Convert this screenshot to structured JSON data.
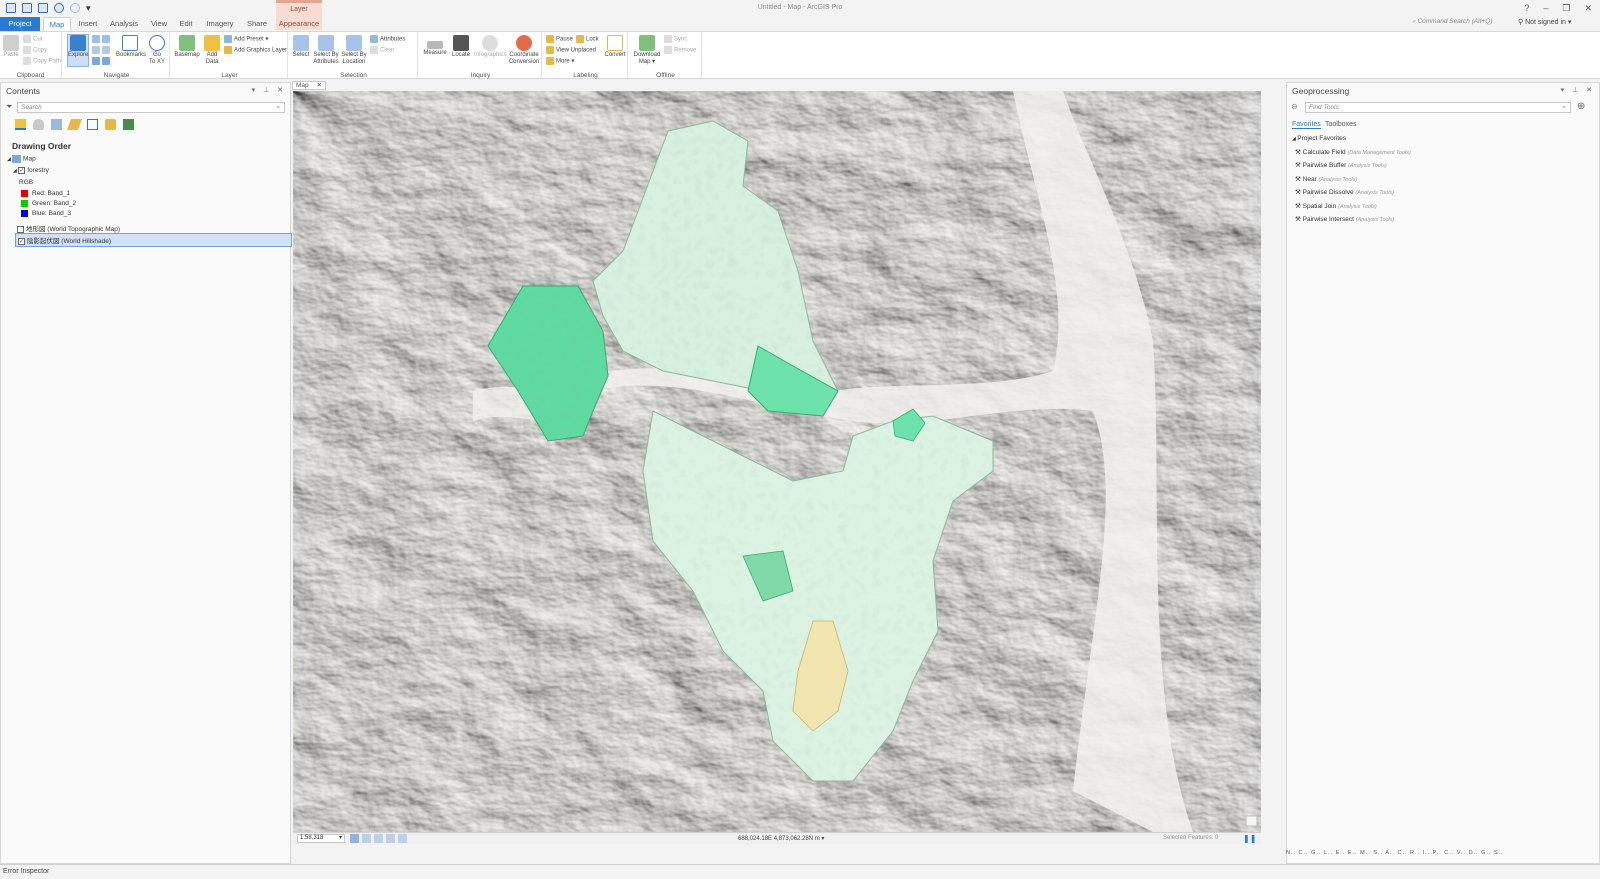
{
  "app": {
    "title": "Untitled - Map - ArcGIS Pro",
    "context_group": "Layer",
    "window_controls": [
      "?",
      "–",
      "❐",
      "✕"
    ]
  },
  "tabs": [
    "Project",
    "Map",
    "Insert",
    "Analysis",
    "View",
    "Edit",
    "Imagery",
    "Share",
    "Appearance"
  ],
  "active_tab": "Map",
  "command_search": "Command Search (Alt+Q)",
  "signin": "Not signed in ▾",
  "ribbon": {
    "clipboard": {
      "label": "Clipboard",
      "paste": "Paste",
      "cut": "Cut",
      "copy": "Copy",
      "copy_path": "Copy Path"
    },
    "navigate": {
      "label": "Navigate",
      "explore": "Explore",
      "bookmarks": "Bookmarks",
      "goto_1": "Go",
      "goto_2": "To XY"
    },
    "layer": {
      "label": "Layer",
      "basemap": "Basemap",
      "add_data_1": "Add",
      "add_data_2": "Data",
      "add_preset": "Add Preset ▾",
      "add_graphics": "Add Graphics Layer"
    },
    "selection": {
      "label": "Selection",
      "select": "Select",
      "by_attr_1": "Select By",
      "by_attr_2": "Attributes",
      "by_loc_1": "Select By",
      "by_loc_2": "Location",
      "attributes": "Attributes",
      "clear": "Clear"
    },
    "inquiry": {
      "label": "Inquiry",
      "measure": "Measure",
      "locate": "Locate",
      "infographics": "Infographics",
      "coord_1": "Coordinate",
      "coord_2": "Conversion"
    },
    "labeling": {
      "label": "Labeling",
      "pause": "Pause",
      "lock": "Lock",
      "view_unplaced": "View Unplaced",
      "more": "More ▾",
      "convert": "Convert"
    },
    "offline": {
      "label": "Offline",
      "download_1": "Download",
      "download_2": "Map ▾",
      "sync": "Sync",
      "remove": "Remove"
    }
  },
  "contents": {
    "title": "Contents",
    "search_placeholder": "Search",
    "drawing_order": "Drawing Order",
    "map": "Map",
    "layer_forestry": "forestry",
    "rgb": "RGB",
    "red": "Red:   Band_1",
    "green": "Green: Band_2",
    "blue": "Blue:  Band_3",
    "topo": "地形図 (World Topographic Map)",
    "hillshade": "陰影起伏図 (World Hillshade)",
    "colors": {
      "red": "#e00000",
      "green": "#00d000",
      "blue": "#0000d0"
    }
  },
  "map_view": {
    "tab_label": "Map",
    "scale": "1:58,318",
    "coordinates": "688,024.18E 4,873,062.28N m  ▾",
    "selected_features": "Selected Features: 0"
  },
  "geoprocessing": {
    "title": "Geoprocessing",
    "find_placeholder": "Find Tools",
    "tab_favorites": "Favorites",
    "tab_toolboxes": "Toolboxes",
    "section": "Project Favorites",
    "tools": [
      {
        "name": "Calculate Field",
        "box": "(Data Management Tools)"
      },
      {
        "name": "Pairwise Buffer",
        "box": "(Analysis Tools)"
      },
      {
        "name": "Near",
        "box": "(Analysis Tools)"
      },
      {
        "name": "Pairwise Dissolve",
        "box": "(Analysis Tools)"
      },
      {
        "name": "Spatial Join",
        "box": "(Analysis Tools)"
      },
      {
        "name": "Pairwise Intersect",
        "box": "(Analysis Tools)"
      }
    ],
    "bottom_tabs": "N..  C..  G..  L..  E..  E..  M..  S..  A..  C..  R..  I..  P..  C..  V..  D..  G..  S.."
  },
  "status": {
    "error_inspector": "Error Inspector"
  }
}
